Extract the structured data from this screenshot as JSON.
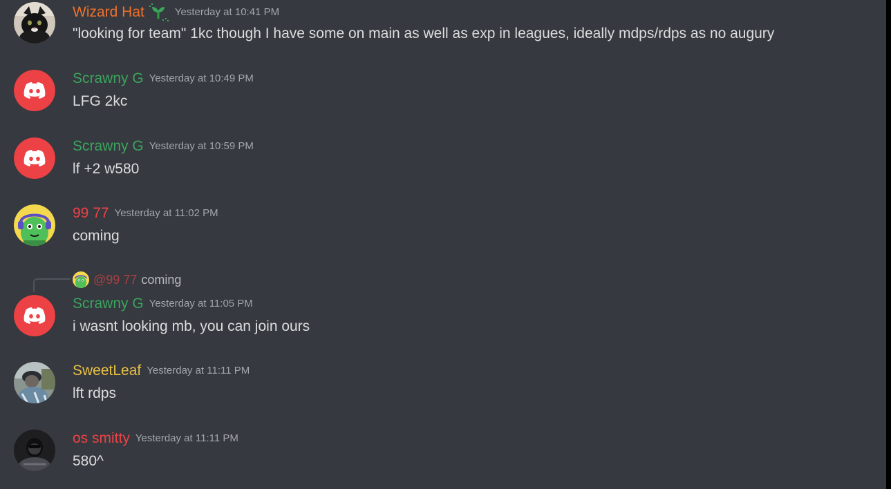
{
  "channel": {
    "messages": [
      {
        "username": "Wizard Hat",
        "username_color": "#f0712c",
        "timestamp": "Yesterday at 10:41 PM",
        "content": "\"looking for team\" 1kc though I have some on main as well as exp in leagues, ideally mdps/rdps as no augury",
        "avatar": "cat-photo-avatar",
        "badge": "sprout-icon"
      },
      {
        "username": "Scrawny G",
        "username_color": "#3ba55d",
        "timestamp": "Yesterday at 10:49 PM",
        "content": "LFG 2kc",
        "avatar": "discord-logo-avatar"
      },
      {
        "username": "Scrawny G",
        "username_color": "#3ba55d",
        "timestamp": "Yesterday at 10:59 PM",
        "content": "lf +2 w580",
        "avatar": "discord-logo-avatar"
      },
      {
        "username": "99 77",
        "username_color": "#ed4245",
        "timestamp": "Yesterday at 11:02 PM",
        "content": "coming",
        "avatar": "green-creature-avatar"
      },
      {
        "username": "Scrawny G",
        "username_color": "#3ba55d",
        "timestamp": "Yesterday at 11:05 PM",
        "content": "i wasnt looking mb, you can join ours",
        "avatar": "discord-logo-avatar",
        "reply": {
          "mention": "@99 77",
          "text": "coming",
          "avatar": "green-creature-avatar"
        }
      },
      {
        "username": "SweetLeaf",
        "username_color": "#e9c145",
        "timestamp": "Yesterday at 11:11 PM",
        "content": "lft rdps",
        "avatar": "person-photo-avatar"
      },
      {
        "username": "os smitty",
        "username_color": "#ed4245",
        "timestamp": "Yesterday at 11:11 PM",
        "content": "580^",
        "avatar": "dark-photo-avatar"
      }
    ]
  },
  "colors": {
    "background": "#36393f",
    "text": "#dcddde",
    "timestamp": "#a3a6aa",
    "discord_red": "#ed4245"
  }
}
